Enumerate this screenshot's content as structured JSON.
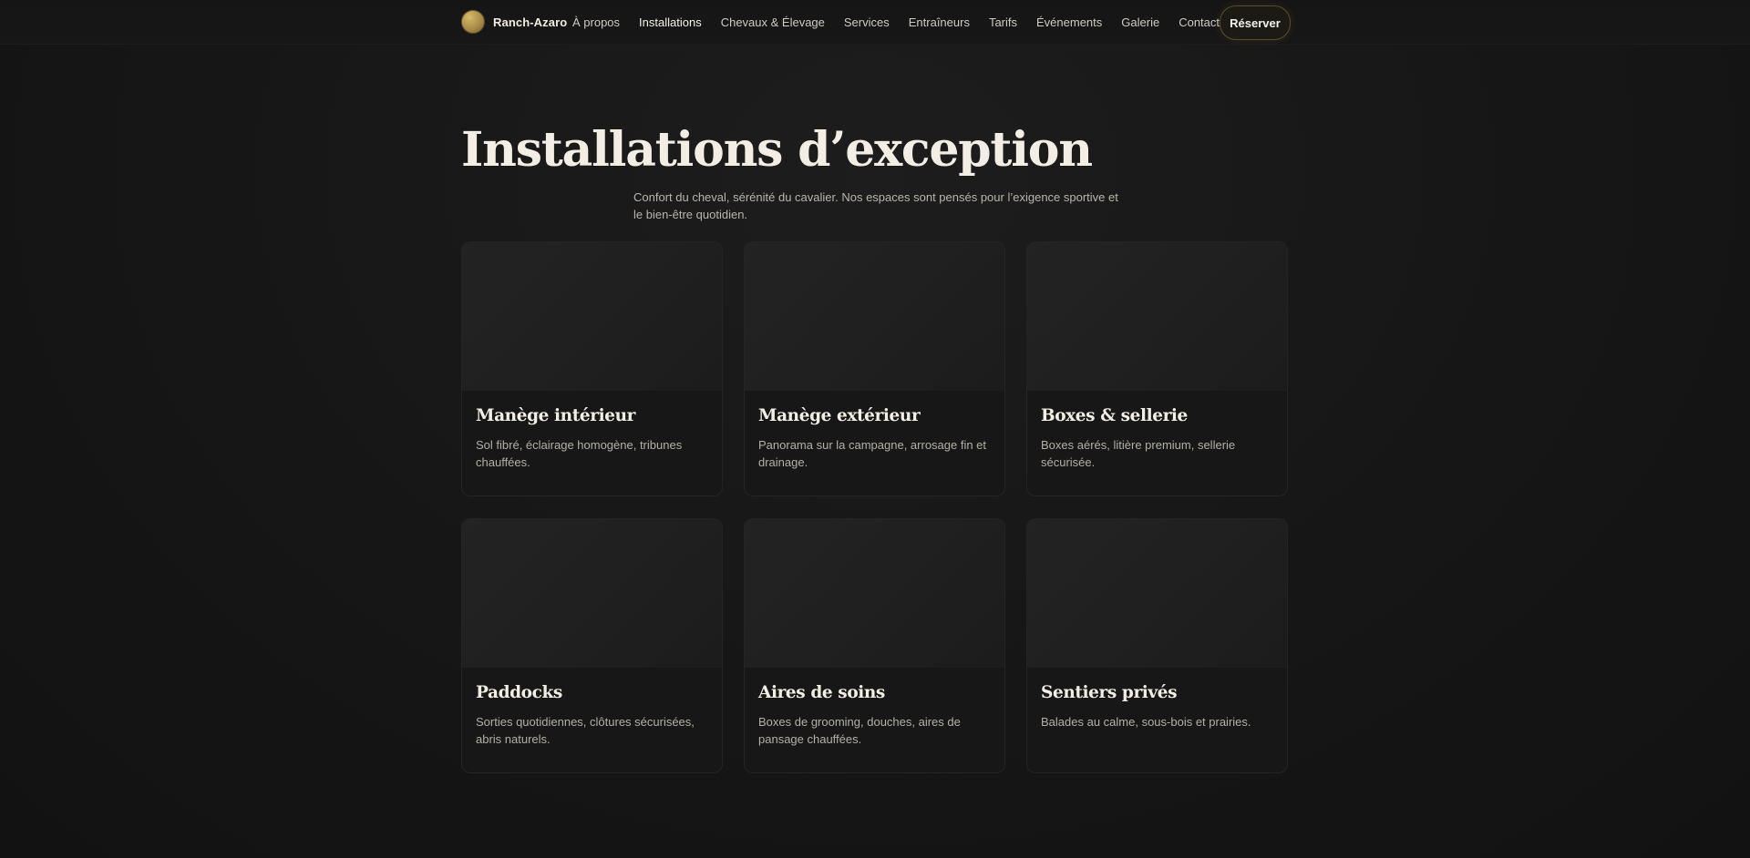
{
  "header": {
    "brand": "Ranch-Azaro",
    "nav": [
      {
        "label": "À propos",
        "active": false
      },
      {
        "label": "Installations",
        "active": true
      },
      {
        "label": "Chevaux & Élevage",
        "active": false
      },
      {
        "label": "Services",
        "active": false
      },
      {
        "label": "Entraîneurs",
        "active": false
      },
      {
        "label": "Tarifs",
        "active": false
      },
      {
        "label": "Événements",
        "active": false
      },
      {
        "label": "Galerie",
        "active": false
      },
      {
        "label": "Contact",
        "active": false
      }
    ],
    "cta": "Réserver"
  },
  "hero": {
    "title": "Installations d’exception",
    "subtitle": "Confort du cheval, sérénité du cavalier. Nos espaces sont pensés pour l’exigence sportive et le bien-être quotidien."
  },
  "cards": [
    {
      "title": "Manège intérieur",
      "desc": "Sol fibré, éclairage homogène, tribunes chauffées."
    },
    {
      "title": "Manège extérieur",
      "desc": "Panorama sur la campagne, arrosage fin et drainage."
    },
    {
      "title": "Boxes & sellerie",
      "desc": "Boxes aérés, litière premium, sellerie sécurisée."
    },
    {
      "title": "Paddocks",
      "desc": "Sorties quotidiennes, clôtures sécurisées, abris naturels."
    },
    {
      "title": "Aires de soins",
      "desc": "Boxes de grooming, douches, aires de pansage chauffées."
    },
    {
      "title": "Sentiers privés",
      "desc": "Balades au calme, sous-bois et prairies."
    }
  ],
  "colors": {
    "background": "#141414",
    "accent": "#a68a46",
    "text": "#f2eee6"
  }
}
